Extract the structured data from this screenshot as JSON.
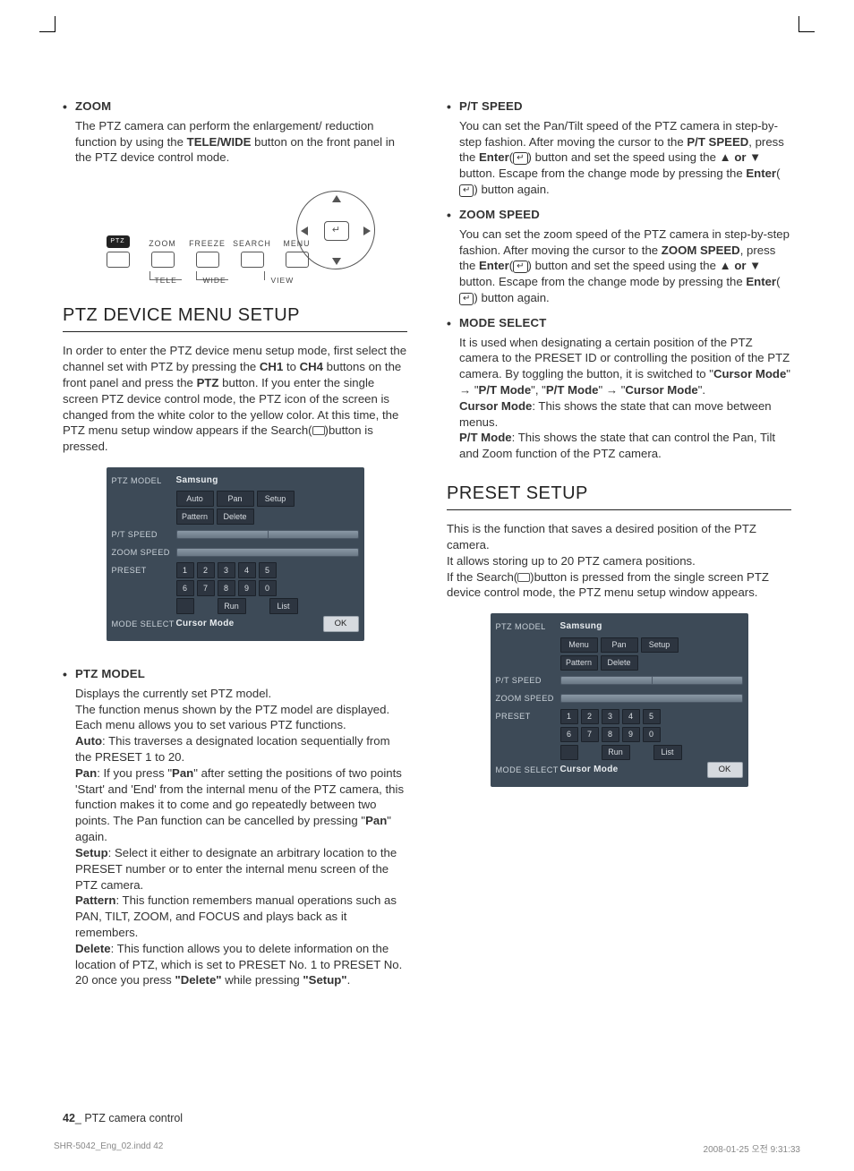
{
  "left": {
    "zoom": {
      "title": "ZOOM",
      "body_pre": "The PTZ camera can perform the enlargement/ reduction function by using the ",
      "body_bold": "TELE/WIDE",
      "body_post": " button on the front panel in the PTZ device control mode."
    },
    "diagram": {
      "ptz": "PTZ",
      "zoom": "ZOOM",
      "freeze": "FREEZE",
      "search": "SEARCH",
      "menu": "MENU",
      "tele": "TELE",
      "wide": "WIDE",
      "view": "VIEW"
    },
    "section1_title": "PTZ DEVICE MENU SETUP",
    "section1_intro_a": "In order to enter the PTZ device menu setup mode, first select the channel set with PTZ by pressing the ",
    "section1_intro_b": "CH1",
    "section1_intro_c": " to ",
    "section1_intro_d": "CH4",
    "section1_intro_e": " buttons on the front panel and press the ",
    "section1_intro_f": "PTZ",
    "section1_intro_g": " button. If you enter the single screen PTZ device control mode, the PTZ icon of the screen is changed from the white color to the yellow color. At this time, the PTZ menu setup window appears if the Search(",
    "section1_intro_h": ")button is pressed.",
    "osd1": {
      "ptz_model_lbl": "PTZ MODEL",
      "ptz_model_val": "Samsung",
      "btn_auto": "Auto",
      "btn_pan": "Pan",
      "btn_setup": "Setup",
      "btn_pattern": "Pattern",
      "btn_delete": "Delete",
      "pt_speed_lbl": "P/T SPEED",
      "zoom_speed_lbl": "ZOOM SPEED",
      "preset_lbl": "PRESET",
      "n1": "1",
      "n2": "2",
      "n3": "3",
      "n4": "4",
      "n5": "5",
      "n6": "6",
      "n7": "7",
      "n8": "8",
      "n9": "9",
      "n0": "0",
      "btn_run": "Run",
      "btn_list": "List",
      "mode_lbl": "MODE SELECT",
      "mode_val": "Cursor Mode",
      "ok": "OK"
    },
    "ptzmodel": {
      "title": "PTZ MODEL",
      "p1": "Displays the currently set PTZ model.",
      "p2": "The function menus shown by the PTZ model are displayed. Each menu allows you to set various PTZ functions.",
      "auto_b": "Auto",
      "auto_t": ": This traverses a designated location sequentially from the PRESET 1 to 20.",
      "pan_b": "Pan",
      "pan_t1": ": If you press \"",
      "pan_q": "Pan",
      "pan_t2": "\" after setting the positions of two points 'Start' and 'End' from the internal menu of the PTZ camera, this function makes it to come and go repeatedly between two points. The Pan function can be cancelled by pressing \"",
      "pan_q2": "Pan",
      "pan_t3": "\" again.",
      "setup_b": "Setup",
      "setup_t": ": Select it either to designate an arbitrary location to the PRESET number or to enter the internal menu screen of the PTZ camera.",
      "pattern_b": "Pattern",
      "pattern_t": ": This function remembers manual operations such as PAN, TILT, ZOOM, and FOCUS and plays back as it remembers.",
      "delete_b": "Delete",
      "delete_t1": ": This function allows you to delete information on the location of PTZ, which is set to PRESET No. 1 to PRESET No. 20 once you press ",
      "delete_q1": "\"Delete\"",
      "delete_t2": " while pressing ",
      "delete_q2": "\"Setup\"",
      "delete_t3": "."
    }
  },
  "right": {
    "ptspeed": {
      "title": "P/T SPEED",
      "t1": "You can set the Pan/Tilt speed of the PTZ camera in step-by-step fashion. After moving the cursor to the ",
      "b1": "P/T SPEED",
      "t2": ", press the ",
      "b2": "Enter",
      "t3": "(",
      "t4": ") button and set the speed using the ▲ ",
      "b3": "or",
      "t5": " ▼ button. Escape from the change mode by pressing the ",
      "b4": "Enter",
      "t6": "(",
      "t7": ") button again."
    },
    "zoomspeed": {
      "title": "ZOOM SPEED",
      "t1": "You can set the zoom speed of the PTZ camera in step-by-step fashion. After moving the cursor to the ",
      "b1": "ZOOM SPEED",
      "t2": ", press the ",
      "b2": "Enter",
      "t3": "(",
      "t4": ") button and set the speed using the ▲ ",
      "b3": "or",
      "t5": " ▼ button. Escape from the change mode by pressing the ",
      "b4": "Enter",
      "t6": "(",
      "t7": ") button again."
    },
    "modeselect": {
      "title": "MODE SELECT",
      "t1": "It is used when designating a certain position of the PTZ camera to the PRESET ID or controlling the position of the PTZ camera. By toggling the button, it is switched to \"",
      "b1": "Cursor Mode",
      "t2": "\" → \"",
      "b2": "P/T Mode",
      "t3": "\", \"",
      "b3": "P/T Mode",
      "t4": "\" → \"",
      "b4": "Cursor Mode",
      "t5": "\".",
      "cm_b": "Cursor Mode",
      "cm_t": ": This shows the state that can move between menus.",
      "pt_b": "P/T Mode",
      "pt_t": ": This shows the state that can control the Pan, Tilt and Zoom function of the PTZ camera."
    },
    "preset_title": "PRESET SETUP",
    "preset_intro1": "This is the function that saves a desired position of the PTZ camera.",
    "preset_intro2": "It allows storing up to 20 PTZ camera positions.",
    "preset_intro3a": "If the Search(",
    "preset_intro3b": ")button is pressed from the single screen PTZ device control mode, the PTZ menu setup window appears.",
    "osd2": {
      "ptz_model_lbl": "PTZ MODEL",
      "ptz_model_val": "Samsung",
      "btn_menu": "Menu",
      "btn_pan": "Pan",
      "btn_setup": "Setup",
      "btn_pattern": "Pattern",
      "btn_delete": "Delete",
      "pt_speed_lbl": "P/T SPEED",
      "zoom_speed_lbl": "ZOOM SPEED",
      "preset_lbl": "PRESET",
      "n1": "1",
      "n2": "2",
      "n3": "3",
      "n4": "4",
      "n5": "5",
      "n6": "6",
      "n7": "7",
      "n8": "8",
      "n9": "9",
      "n0": "0",
      "btn_run": "Run",
      "btn_list": "List",
      "mode_lbl": "MODE SELECT",
      "mode_val": "Cursor Mode",
      "ok": "OK"
    }
  },
  "footer": {
    "page": "42",
    "sep": "_",
    "label": " PTZ camera control"
  },
  "printline": {
    "file": "SHR-5042_Eng_02.indd   42",
    "date": "2008-01-25   오전 9:31:33"
  }
}
